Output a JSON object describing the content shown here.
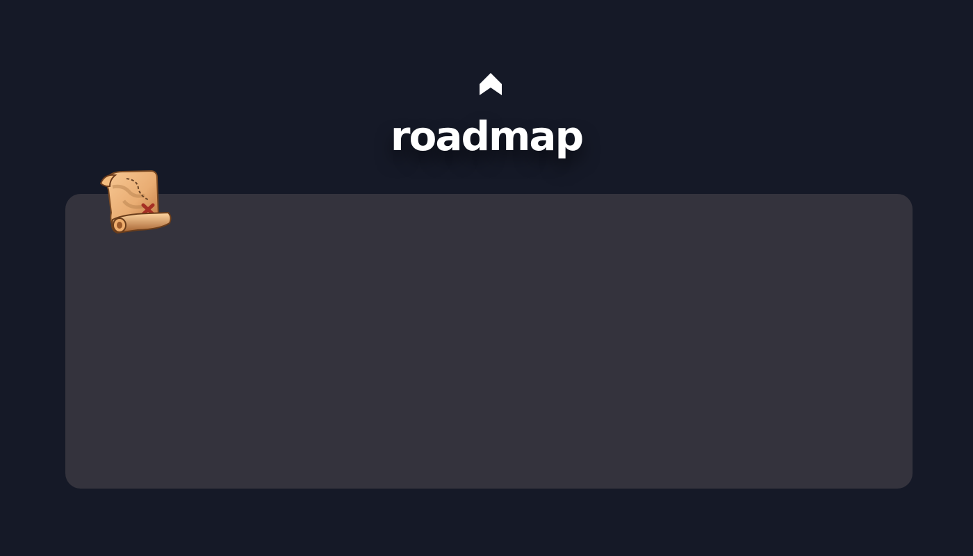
{
  "header": {
    "logo_icon": "up-chevron-icon",
    "title": "roadmap"
  },
  "panel": {
    "badge_icon": "treasure-map-scroll-icon"
  },
  "colors": {
    "background": "#151927",
    "panel": "#34333d",
    "title": "#ffffff"
  }
}
